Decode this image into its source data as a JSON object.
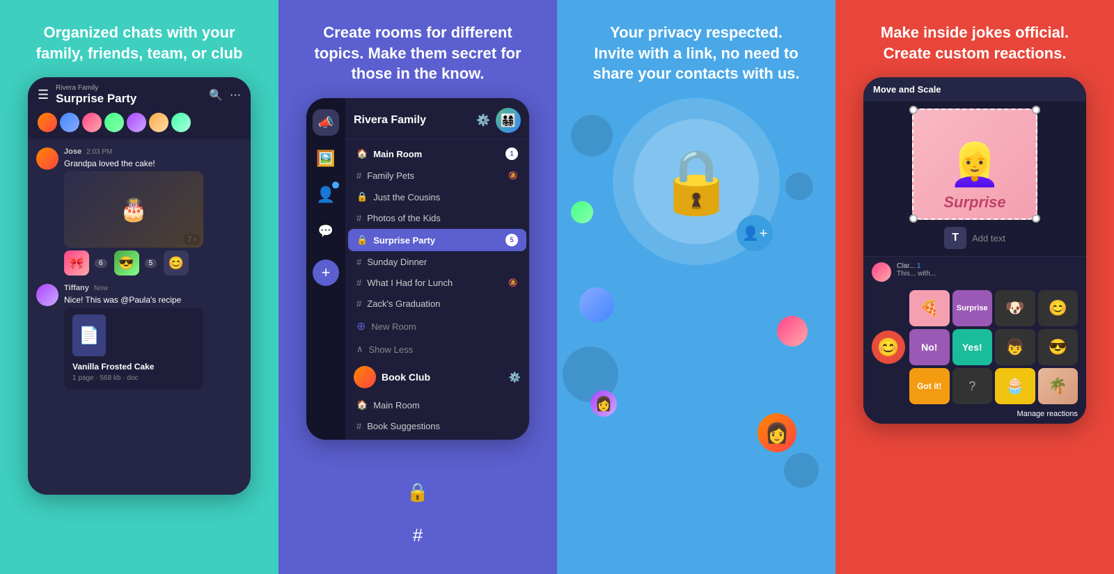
{
  "panel1": {
    "bg": "#3ecfbf",
    "headline": "Organized chats with your family, friends, team, or club",
    "phone": {
      "header": {
        "small_label": "Rivera Family",
        "title": "Surprise Party",
        "icons": [
          "☰",
          "🔍",
          "···"
        ]
      },
      "messages": [
        {
          "sender": "Jose",
          "time": "2:03 PM",
          "text": "Grandpa loved the cake!",
          "has_image": true,
          "image_count": "7 ›"
        },
        {
          "stickers": [
            {
              "emoji": "🎀",
              "count": "6"
            },
            {
              "emoji": "😎",
              "count": "5"
            },
            {
              "emoji": "😊",
              "count": ""
            }
          ]
        },
        {
          "sender": "Tiffany",
          "time": "Now",
          "text": "Nice! This was @Paula's recipe",
          "file": {
            "name": "Vanilla Frosted Cake",
            "meta": "1 page · 568 kb · doc"
          }
        }
      ]
    }
  },
  "panel2": {
    "bg": "#5b5fcf",
    "headline": "Create rooms for different topics. Make them secret for those in the know.",
    "phone": {
      "group_name": "Rivera Family",
      "rooms": [
        {
          "icon": "🏠",
          "name": "Main Room",
          "badge": "1",
          "type": "main",
          "active": false
        },
        {
          "icon": "#",
          "name": "Family Pets",
          "badge": "",
          "type": "hash",
          "mute": "🔕"
        },
        {
          "icon": "🔒",
          "name": "Just the Cousins",
          "badge": "",
          "type": "lock"
        },
        {
          "icon": "#",
          "name": "Photos of the Kids",
          "badge": "",
          "type": "hash"
        },
        {
          "icon": "🔒",
          "name": "Surprise Party",
          "badge": "5",
          "type": "lock",
          "active": true
        },
        {
          "icon": "#",
          "name": "Sunday Dinner",
          "badge": "",
          "type": "hash"
        },
        {
          "icon": "#",
          "name": "What I Had for Lunch",
          "badge": "",
          "type": "hash",
          "mute": "🔕"
        },
        {
          "icon": "#",
          "name": "Zack's Graduation",
          "badge": "",
          "type": "hash"
        },
        {
          "icon": "+",
          "name": "New Room",
          "badge": "",
          "type": "add"
        },
        {
          "icon": "^",
          "name": "Show Less",
          "badge": "",
          "type": "collapse"
        }
      ],
      "book_club": {
        "name": "Book Club",
        "rooms": [
          {
            "icon": "🏠",
            "name": "Main Room"
          },
          {
            "icon": "#",
            "name": "Book Suggestions"
          }
        ]
      }
    }
  },
  "panel3": {
    "bg": "#4aa8e8",
    "headline": "Your privacy respected. Invite with a link, no need to share your contacts with us."
  },
  "panel4": {
    "bg": "#e8463a",
    "headline": "Make inside jokes official. Create custom reactions.",
    "toolbar": {
      "title": "Move and Scale"
    },
    "text_tool": "Add text",
    "reactions": [
      {
        "type": "image",
        "emoji": "🍕",
        "bg": "pink"
      },
      {
        "type": "text",
        "label": "Surprise",
        "bg": "purple"
      },
      {
        "type": "image",
        "emoji": "🐶",
        "bg": "dark-img"
      },
      {
        "type": "image",
        "emoji": "😊",
        "bg": "dark-img"
      },
      {
        "type": "text",
        "label": "No!",
        "bg": "purple"
      },
      {
        "type": "text",
        "label": "Yes!",
        "bg": "teal"
      },
      {
        "type": "image",
        "emoji": "👦",
        "bg": "dark-img"
      },
      {
        "type": "image",
        "emoji": "😎",
        "bg": "dark-img"
      },
      {
        "type": "text",
        "label": "Got it!",
        "bg": "orange"
      },
      {
        "type": "text",
        "label": "?",
        "bg": "dark-img"
      },
      {
        "type": "image",
        "emoji": "🧁",
        "bg": "yellow"
      },
      {
        "type": "image",
        "emoji": "🌴",
        "bg": "dark-img"
      }
    ],
    "manage_label": "Manage reactions"
  }
}
